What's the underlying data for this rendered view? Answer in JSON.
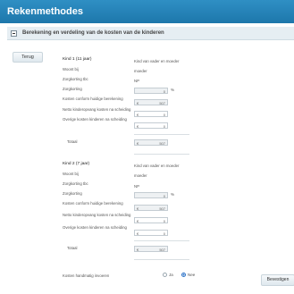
{
  "header": {
    "title": "Rekenmethodes"
  },
  "section": {
    "title": "Berekening en verdeling van de kosten van de kinderen"
  },
  "back_button": "Terug",
  "children": [
    {
      "title": "Kind 1 (11 jaar)",
      "title_value": "Kind van vader en moeder",
      "woont_bij_label": "Woont bij",
      "woont_bij_value": "moeder",
      "zorgkorting_tbc_label": "Zorgkorting tbc",
      "zorgkorting_tbc_value": "NP",
      "zorgkorting_label": "Zorgkorting",
      "zorgkorting_value": "0",
      "zorgkorting_unit": "%",
      "kosten_label": "Kosten conform huidige berekening",
      "kosten_currency": "€",
      "kosten_value": "507",
      "netto_label": "Netto kinderopvang kosten na scheiding",
      "netto_currency": "€",
      "netto_value": "0",
      "overige_label": "Overige kosten kinderen na scheiding",
      "overige_currency": "€",
      "overige_value": "0",
      "totaal_label": "Totaal",
      "totaal_currency": "€",
      "totaal_value": "507"
    },
    {
      "title": "Kind 2 (7 jaar)",
      "title_value": "Kind van vader en moeder",
      "woont_bij_label": "Woont bij",
      "woont_bij_value": "moeder",
      "zorgkorting_tbc_label": "Zorgkorting tbc",
      "zorgkorting_tbc_value": "NP",
      "zorgkorting_label": "Zorgkorting",
      "zorgkorting_value": "0",
      "zorgkorting_unit": "%",
      "kosten_label": "Kosten conform huidige berekening",
      "kosten_currency": "€",
      "kosten_value": "507",
      "netto_label": "Netto kinderopvang kosten na scheiding",
      "netto_currency": "€",
      "netto_value": "0",
      "overige_label": "Overige kosten kinderen na scheiding",
      "overige_currency": "€",
      "overige_value": "0",
      "totaal_label": "Totaal",
      "totaal_currency": "€",
      "totaal_value": "507"
    }
  ],
  "manual": {
    "label": "Kosten handmatig invoeren",
    "option_ja": "Ja",
    "option_nee": "Nee",
    "selected": "Nee"
  },
  "confirm_button": "Bevestigen"
}
